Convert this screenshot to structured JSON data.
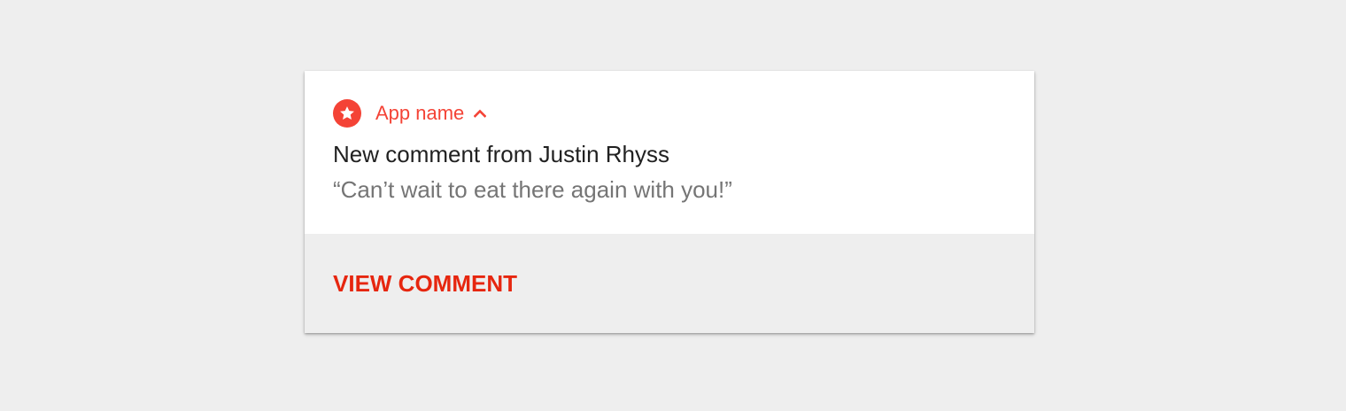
{
  "notification": {
    "app_name": "App name",
    "app_icon": "star-icon",
    "expand_icon": "chevron-up-icon",
    "title": "New comment from Justin Rhyss",
    "text": "“Can’t wait to eat there again with you!”",
    "action_label": "VIEW COMMENT"
  },
  "colors": {
    "accent": "#f44336",
    "action": "#e6260f",
    "background": "#eeeeee",
    "card": "#ffffff",
    "title_text": "#212121",
    "body_text": "#757575"
  }
}
